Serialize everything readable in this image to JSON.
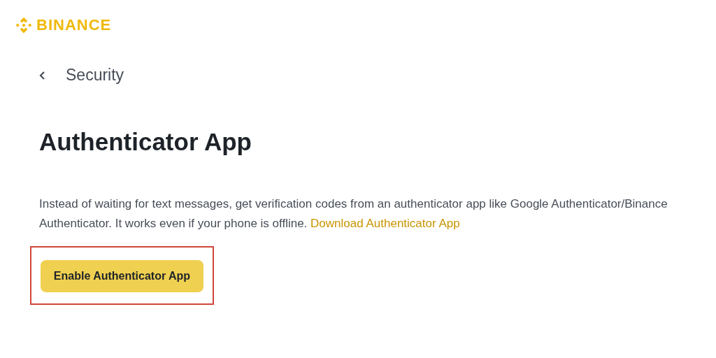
{
  "logo": {
    "text": "BINANCE"
  },
  "back_link": {
    "label": "Security"
  },
  "title": "Authenticator App",
  "description": {
    "text": "Instead of waiting for text messages, get verification codes from an authenticator app like Google Authenticator/Binance Authenticator. It works even if your phone is offline.",
    "link": "Download Authenticator App"
  },
  "button": {
    "label": "Enable Authenticator App",
    "highlighted": true
  }
}
